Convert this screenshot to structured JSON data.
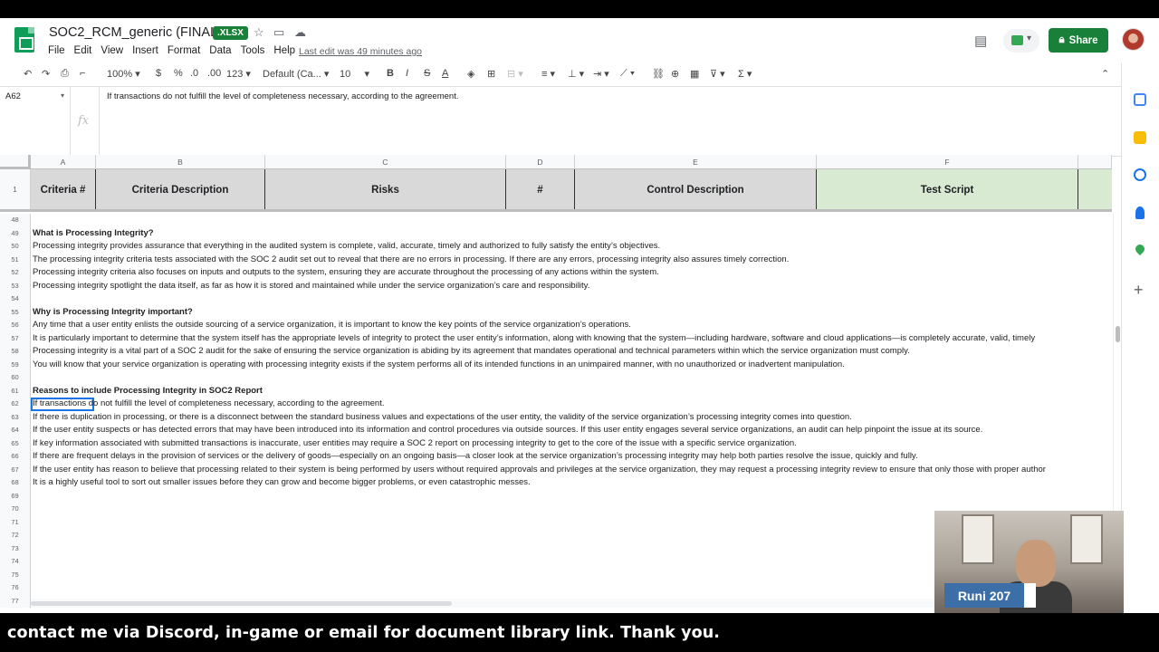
{
  "header": {
    "doc_title": "SOC2_RCM_generic (FINAL)",
    "badge": ".XLSX",
    "menu": [
      "File",
      "Edit",
      "View",
      "Insert",
      "Format",
      "Data",
      "Tools",
      "Help"
    ],
    "last_edit": "Last edit was 49 minutes ago",
    "share_label": "Share"
  },
  "toolbar": {
    "zoom": "100%",
    "currency": "$",
    "percent": "%",
    "dec_less": ".0",
    "dec_more": ".00",
    "more_formats": "123",
    "font": "Default (Ca...",
    "font_size": "10",
    "bold": "B",
    "italic": "I",
    "strike": "S",
    "text_color": "A",
    "sigma": "Σ"
  },
  "formula_bar": {
    "name_box": "A62",
    "fx": "fx",
    "content": "If transactions do not fulfill the level of completeness necessary, according to the agreement."
  },
  "columns": [
    "A",
    "B",
    "C",
    "D",
    "E",
    "F"
  ],
  "frozen_headers": [
    "Criteria #",
    "Criteria Description",
    "Risks",
    "#",
    "Control Description",
    "Test Script"
  ],
  "row1_num": "1",
  "rows": [
    {
      "n": "48",
      "text": "",
      "bold": false
    },
    {
      "n": "49",
      "text": "What is Processing Integrity?",
      "bold": true
    },
    {
      "n": "50",
      "text": "Processing integrity provides assurance that everything in the audited system is complete, valid, accurate, timely and authorized to fully satisfy the entity’s objectives.",
      "bold": false
    },
    {
      "n": "51",
      "text": "The processing integrity criteria tests associated with the SOC 2 audit set out to reveal that there are no errors in processing. If there are any errors, processing integrity also assures timely correction.",
      "bold": false
    },
    {
      "n": "52",
      "text": "Processing integrity criteria also focuses on inputs and outputs to the system, ensuring they are accurate throughout the processing of any actions within the system.",
      "bold": false
    },
    {
      "n": "53",
      "text": "Processing integrity spotlight the data itself, as far as how it is stored and maintained while under the service organization’s care and responsibility.",
      "bold": false
    },
    {
      "n": "54",
      "text": "",
      "bold": false
    },
    {
      "n": "55",
      "text": "Why is Processing Integrity important?",
      "bold": true
    },
    {
      "n": "56",
      "text": "Any time that a user entity enlists the outside sourcing of a service organization, it is important to know the key points of the service organization’s operations.",
      "bold": false
    },
    {
      "n": "57",
      "text": "It is particularly important to determine that the system itself has the appropriate levels of integrity to protect the user entity’s information, along with knowing that the system—including hardware, software and cloud applications—is completely accurate, valid, timely",
      "bold": false
    },
    {
      "n": "58",
      "text": "Processing integrity is a vital part of a SOC 2 audit for the sake of ensuring the service organization is abiding by its agreement that mandates operational and technical parameters within which the service organization must comply.",
      "bold": false
    },
    {
      "n": "59",
      "text": "You will know that your service organization is operating with processing integrity exists if the system performs all of its intended functions in an unimpaired manner, with no unauthorized or inadvertent manipulation.",
      "bold": false
    },
    {
      "n": "60",
      "text": "",
      "bold": false
    },
    {
      "n": "61",
      "text": "Reasons to include Processing Integrity in SOC2 Report",
      "bold": true
    },
    {
      "n": "62",
      "text": "If transactions do not fulfill the level of completeness necessary, according to the agreement.",
      "bold": false
    },
    {
      "n": "63",
      "text": "If there is duplication in processing, or there is a disconnect between the standard business values and expectations of the user entity, the validity of the service organization’s processing integrity comes into question.",
      "bold": false
    },
    {
      "n": "64",
      "text": "If the user entity suspects or has detected errors that may have been introduced into its information and control procedures via outside sources. If this user entity engages several service organizations, an audit can help pinpoint the issue at its source.",
      "bold": false
    },
    {
      "n": "65",
      "text": "If key information associated with submitted transactions is inaccurate, user entities may require a SOC 2 report on processing integrity to get to the core of the issue with a specific service organization.",
      "bold": false
    },
    {
      "n": "66",
      "text": "If there are frequent delays in the provision of services or the delivery of goods—especially on an ongoing basis—a closer look at the service organization’s processing integrity may help both parties resolve the issue, quickly and fully.",
      "bold": false
    },
    {
      "n": "67",
      "text": "If the user entity has reason to believe that processing related to their system is being performed by users without required approvals and privileges at the service organization, they may request a processing integrity review to ensure that only those with proper author",
      "bold": false
    },
    {
      "n": "68",
      "text": "It is a highly useful tool to sort out smaller issues before they can grow and become bigger problems, or even catastrophic messes.",
      "bold": false
    },
    {
      "n": "69",
      "text": "",
      "bold": false
    },
    {
      "n": "70",
      "text": "",
      "bold": false
    },
    {
      "n": "71",
      "text": "",
      "bold": false
    },
    {
      "n": "72",
      "text": "",
      "bold": false
    },
    {
      "n": "73",
      "text": "",
      "bold": false
    },
    {
      "n": "74",
      "text": "",
      "bold": false
    },
    {
      "n": "75",
      "text": "",
      "bold": false
    },
    {
      "n": "76",
      "text": "",
      "bold": false
    },
    {
      "n": "77",
      "text": "",
      "bold": false
    }
  ],
  "webcam": {
    "label": "Runi 207"
  },
  "caption": "contact me via Discord, in-game or email for document library link. Thank you.",
  "colors": {
    "green_header": "#d9ead3",
    "gray_header": "#d9d9d9",
    "share": "#188038",
    "selection": "#1a73e8"
  }
}
